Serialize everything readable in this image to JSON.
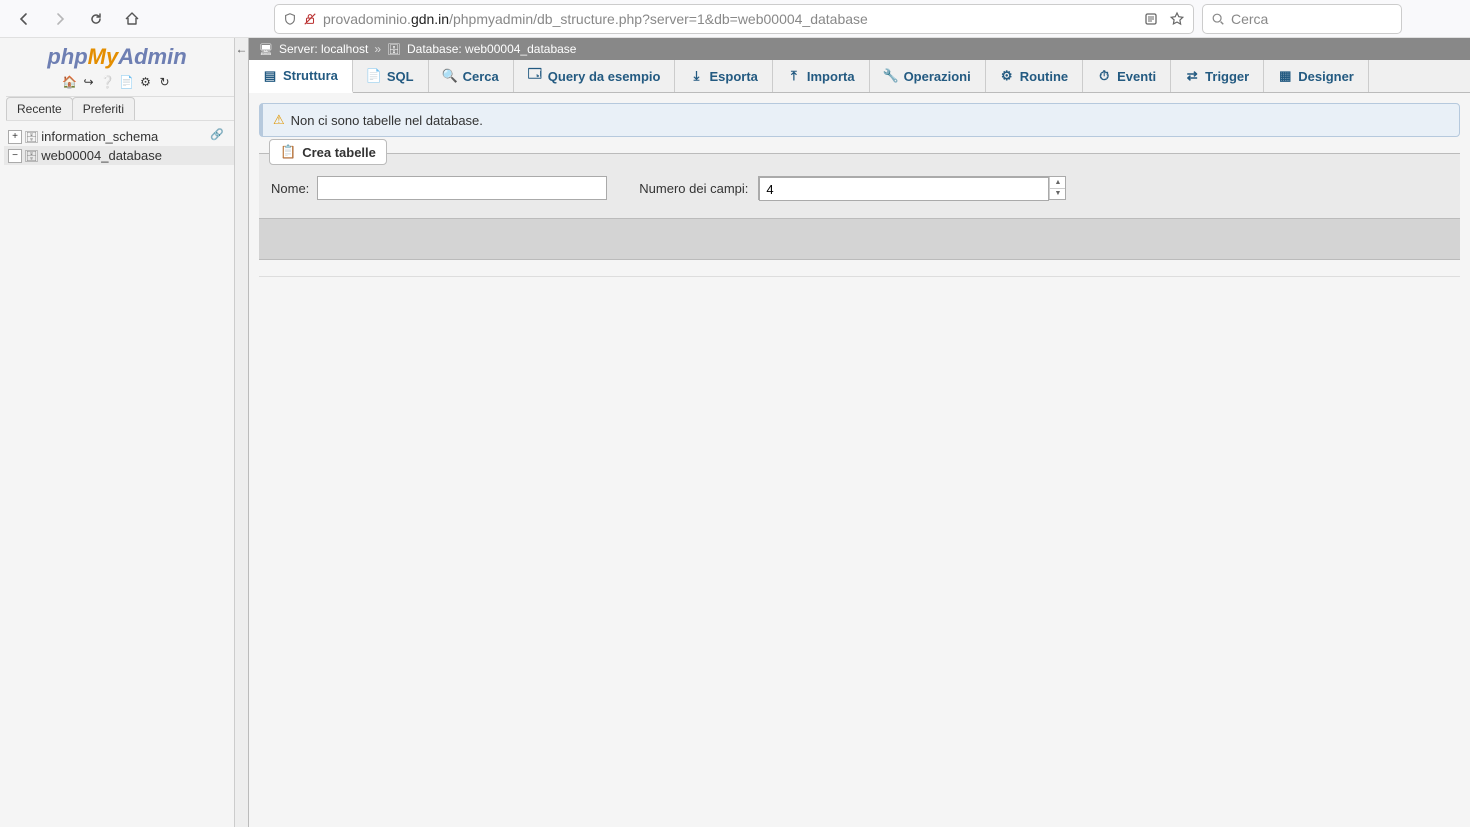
{
  "browser": {
    "url_host_prefix": "provadominio.",
    "url_domain": "gdn.in",
    "url_path": "/phpmyadmin/db_structure.php?server=1&db=web00004_database",
    "search_placeholder": "Cerca"
  },
  "logo": {
    "php": "php",
    "my": "My",
    "admin": "Admin"
  },
  "sidebar": {
    "tabs": [
      "Recente",
      "Preferiti"
    ],
    "tree": [
      {
        "label": "information_schema",
        "expandable": true,
        "expanded": false
      },
      {
        "label": "web00004_database",
        "expandable": true,
        "expanded": true,
        "active": true
      }
    ]
  },
  "breadcrumb": {
    "server_label": "Server: localhost",
    "db_label": "Database: web00004_database"
  },
  "tabs": [
    {
      "label": "Struttura",
      "icon": "structure",
      "active": true
    },
    {
      "label": "SQL",
      "icon": "sql"
    },
    {
      "label": "Cerca",
      "icon": "search"
    },
    {
      "label": "Query da esempio",
      "icon": "query"
    },
    {
      "label": "Esporta",
      "icon": "export"
    },
    {
      "label": "Importa",
      "icon": "import"
    },
    {
      "label": "Operazioni",
      "icon": "ops"
    },
    {
      "label": "Routine",
      "icon": "routine"
    },
    {
      "label": "Eventi",
      "icon": "events"
    },
    {
      "label": "Trigger",
      "icon": "trigger"
    },
    {
      "label": "Designer",
      "icon": "designer"
    }
  ],
  "alert": {
    "msg": "Non ci sono tabelle nel database."
  },
  "create": {
    "legend": "Crea tabelle",
    "name_label": "Nome:",
    "cols_label": "Numero dei campi:",
    "cols_value": "4"
  }
}
